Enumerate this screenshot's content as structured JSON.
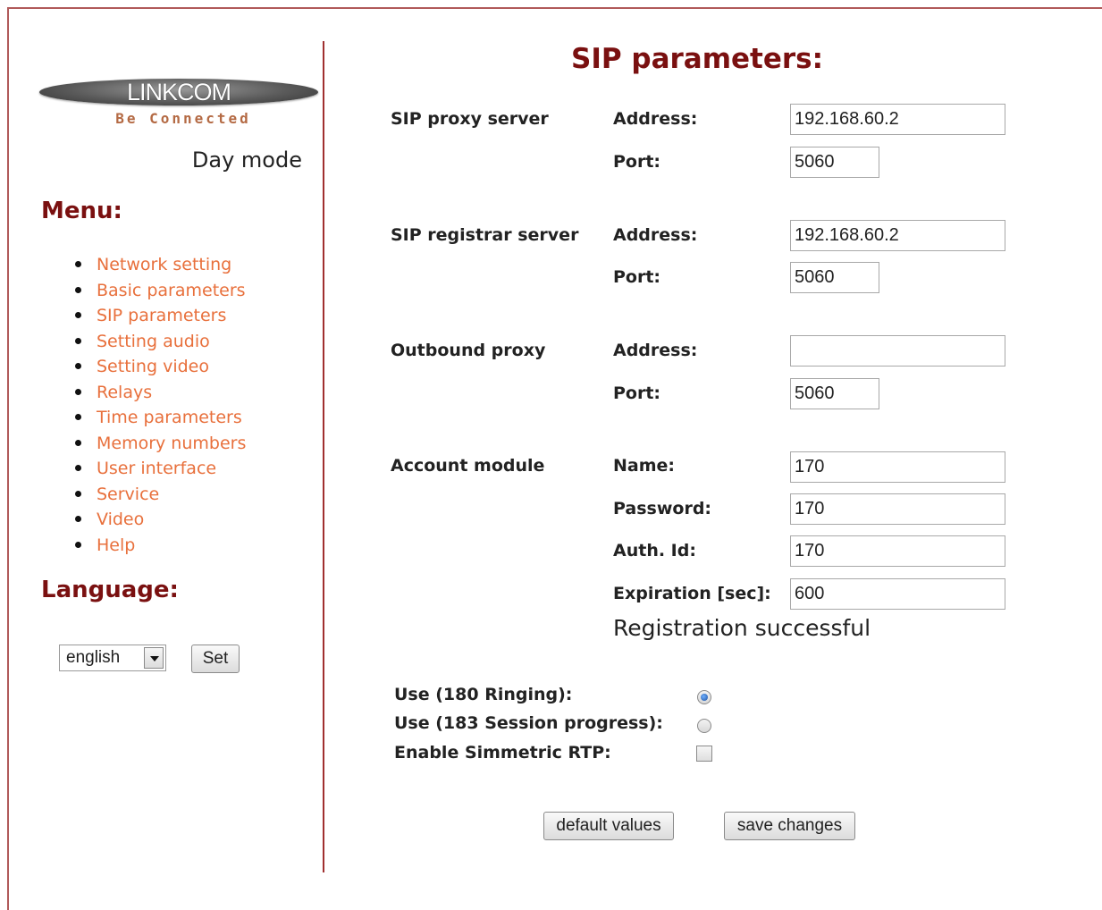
{
  "sidebar": {
    "logo_text": "LINKCOM",
    "logo_tagline": "Be Connected",
    "mode": "Day mode",
    "menu_heading": "Menu:",
    "menu_items": [
      "Network setting",
      "Basic parameters",
      "SIP parameters",
      "Setting audio",
      "Setting video",
      "Relays",
      "Time parameters",
      "Memory numbers",
      "User interface",
      "Service",
      "Video",
      "Help"
    ],
    "language_heading": "Language:",
    "language_value": "english",
    "set_button": "Set"
  },
  "main": {
    "title": "SIP parameters:",
    "proxy": {
      "section": "SIP proxy server",
      "address_label": "Address:",
      "address_value": "192.168.60.2",
      "port_label": "Port:",
      "port_value": "5060"
    },
    "registrar": {
      "section": "SIP registrar server",
      "address_label": "Address:",
      "address_value": "192.168.60.2",
      "port_label": "Port:",
      "port_value": "5060"
    },
    "outbound": {
      "section": "Outbound proxy",
      "address_label": "Address:",
      "address_value": "",
      "port_label": "Port:",
      "port_value": "5060"
    },
    "account": {
      "section": "Account module",
      "name_label": "Name:",
      "name_value": "170",
      "password_label": "Password:",
      "password_value": "170",
      "auth_label": "Auth. Id:",
      "auth_value": "170",
      "expiration_label": "Expiration [sec]:",
      "expiration_value": "600",
      "status": "Registration successful"
    },
    "options": {
      "ringing_label": "Use (180 Ringing):",
      "ringing_selected": true,
      "session_label": "Use (183 Session progress):",
      "session_selected": false,
      "rtp_label": "Enable Simmetric RTP:",
      "rtp_checked": false
    },
    "default_button": "default values",
    "save_button": "save changes"
  },
  "colors": {
    "heading": "#7a1010",
    "menu_link": "#e8703c",
    "divider": "#a03030"
  }
}
